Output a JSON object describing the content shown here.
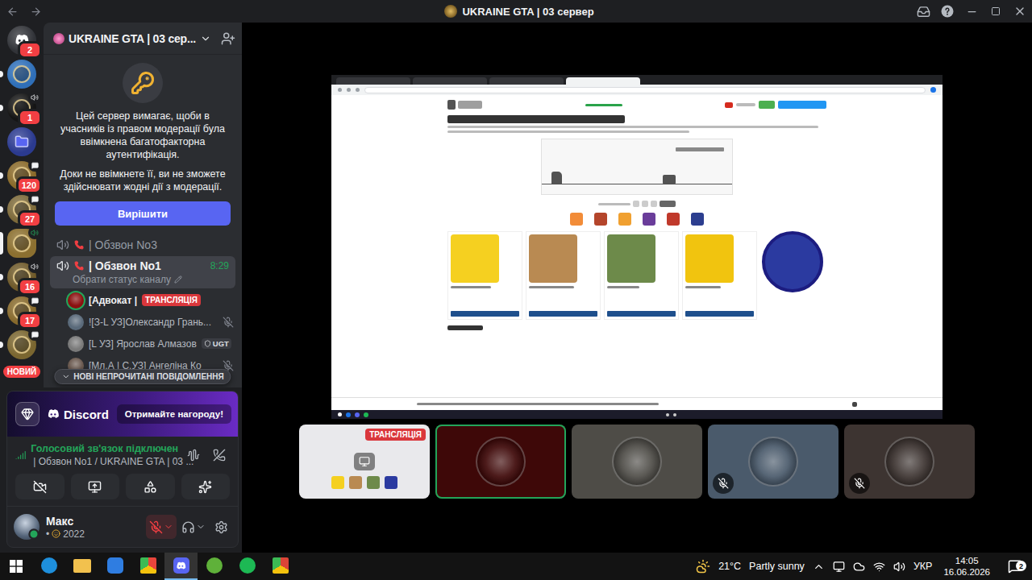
{
  "window": {
    "title": "UKRAINE GTA | 03 сервер"
  },
  "servers": [
    {
      "kind": "home",
      "badge": "2",
      "unread": false,
      "selected": false,
      "activity": "none",
      "color": "#313338"
    },
    {
      "kind": "server",
      "badge": "",
      "unread": true,
      "selected": false,
      "activity": "none",
      "color": "#2f6fb8"
    },
    {
      "kind": "server",
      "badge": "1",
      "unread": true,
      "selected": false,
      "activity": "voice",
      "color": "#151515"
    },
    {
      "kind": "folder",
      "badge": "",
      "unread": false,
      "selected": false,
      "activity": "none",
      "color": "#2b3a8f"
    },
    {
      "kind": "server",
      "badge": "120",
      "unread": true,
      "selected": false,
      "activity": "chat",
      "color": "#8a6a2a"
    },
    {
      "kind": "server",
      "badge": "27",
      "unread": true,
      "selected": false,
      "activity": "chat",
      "color": "#7d6a3a"
    },
    {
      "kind": "server",
      "badge": "",
      "unread": false,
      "selected": true,
      "activity": "live",
      "color": "#8c7030"
    },
    {
      "kind": "server",
      "badge": "16",
      "unread": true,
      "selected": false,
      "activity": "voice",
      "color": "#6f5a2a"
    },
    {
      "kind": "server",
      "badge": "17",
      "unread": true,
      "selected": false,
      "activity": "chat",
      "color": "#86692c"
    },
    {
      "kind": "server",
      "badge": "",
      "unread": true,
      "selected": false,
      "activity": "chat",
      "color": "#7a6630"
    }
  ],
  "rail_new_badge": "НОВИЙ",
  "server_header": {
    "name": "UKRAINE GTA | 03 сер..."
  },
  "mfa_notice": {
    "text": "Цей сервер вимагає, щоби в учасників із правом модерації була ввімкнена багатофакторна аутентифікація.",
    "hint": "Доки не ввімкнете її, ви не зможете здійснювати жодні дії з модерації.",
    "button": "Вирішити"
  },
  "channels": [
    {
      "name": "| Обзвон No3",
      "selected": false,
      "time": "",
      "status": ""
    },
    {
      "name": "| Обзвон No1",
      "selected": true,
      "time": "8:29",
      "status": "Обрати статус каналу"
    }
  ],
  "voice_users": [
    {
      "name": "[Адвокат |",
      "badge": "ТРАНСЛЯЦІЯ",
      "tag": "",
      "muted": false,
      "speaking": true,
      "color": "#8b1111"
    },
    {
      "name": "![З-L УЗ]Олександр Грань...",
      "badge": "",
      "tag": "",
      "muted": true,
      "speaking": false,
      "color": "#5a6a7a"
    },
    {
      "name": "[L УЗ] Ярослав Алмазов",
      "badge": "",
      "tag": "UGT",
      "muted": false,
      "speaking": false,
      "color": "#7a7a7a"
    },
    {
      "name": "[Мл.А | С.УЗ] Ангеліна Ко",
      "badge": "",
      "tag": "",
      "muted": true,
      "speaking": false,
      "color": "#6b5a50"
    }
  ],
  "unread_pill": "НОВІ НЕПРОЧИТАНІ ПОВІДОМЛЕННЯ",
  "promo": {
    "brand": "Discord",
    "button": "Отримайте нагороду!"
  },
  "voice_status": {
    "title": "Голосовий зв'язок підключен",
    "channel": "| Обзвон No1 / UKRAINE GTA | 03 ..."
  },
  "user": {
    "name": "Макс",
    "status_prefix": "•",
    "status": "2022",
    "mic_muted": true
  },
  "tiles": [
    {
      "kind": "stream",
      "badge": "ТРАНСЛЯЦІЯ",
      "muted": false,
      "speaking": false,
      "color": "#3a3a3d"
    },
    {
      "kind": "avatar",
      "badge": "",
      "muted": false,
      "speaking": true,
      "color": "#3e0808"
    },
    {
      "kind": "avatar",
      "badge": "",
      "muted": false,
      "speaking": false,
      "color": "#4e4c47"
    },
    {
      "kind": "avatar",
      "badge": "",
      "muted": true,
      "speaking": false,
      "color": "#4a5a6b"
    },
    {
      "kind": "avatar",
      "badge": "",
      "muted": true,
      "speaking": false,
      "color": "#3d3431"
    }
  ],
  "taskbar": {
    "apps": [
      {
        "kind": "edge",
        "color": "#1e8fdc",
        "selected": false
      },
      {
        "kind": "explorer",
        "color": "#f2c14e",
        "selected": false
      },
      {
        "kind": "mail",
        "color": "#2f7de1",
        "selected": false
      },
      {
        "kind": "chrome",
        "color": "#e8453c",
        "selected": false
      },
      {
        "kind": "discord",
        "color": "#5865f2",
        "selected": true
      },
      {
        "kind": "utorrent",
        "color": "#5fb13a",
        "selected": false
      },
      {
        "kind": "spotify",
        "color": "#1db954",
        "selected": false
      },
      {
        "kind": "chrome",
        "color": "#db4437",
        "selected": false
      }
    ],
    "weather": {
      "temp": "21°C",
      "text": "Partly sunny"
    },
    "language": "УКР",
    "time": "14:05",
    "date": "16.06.2026",
    "notifications": "2"
  }
}
